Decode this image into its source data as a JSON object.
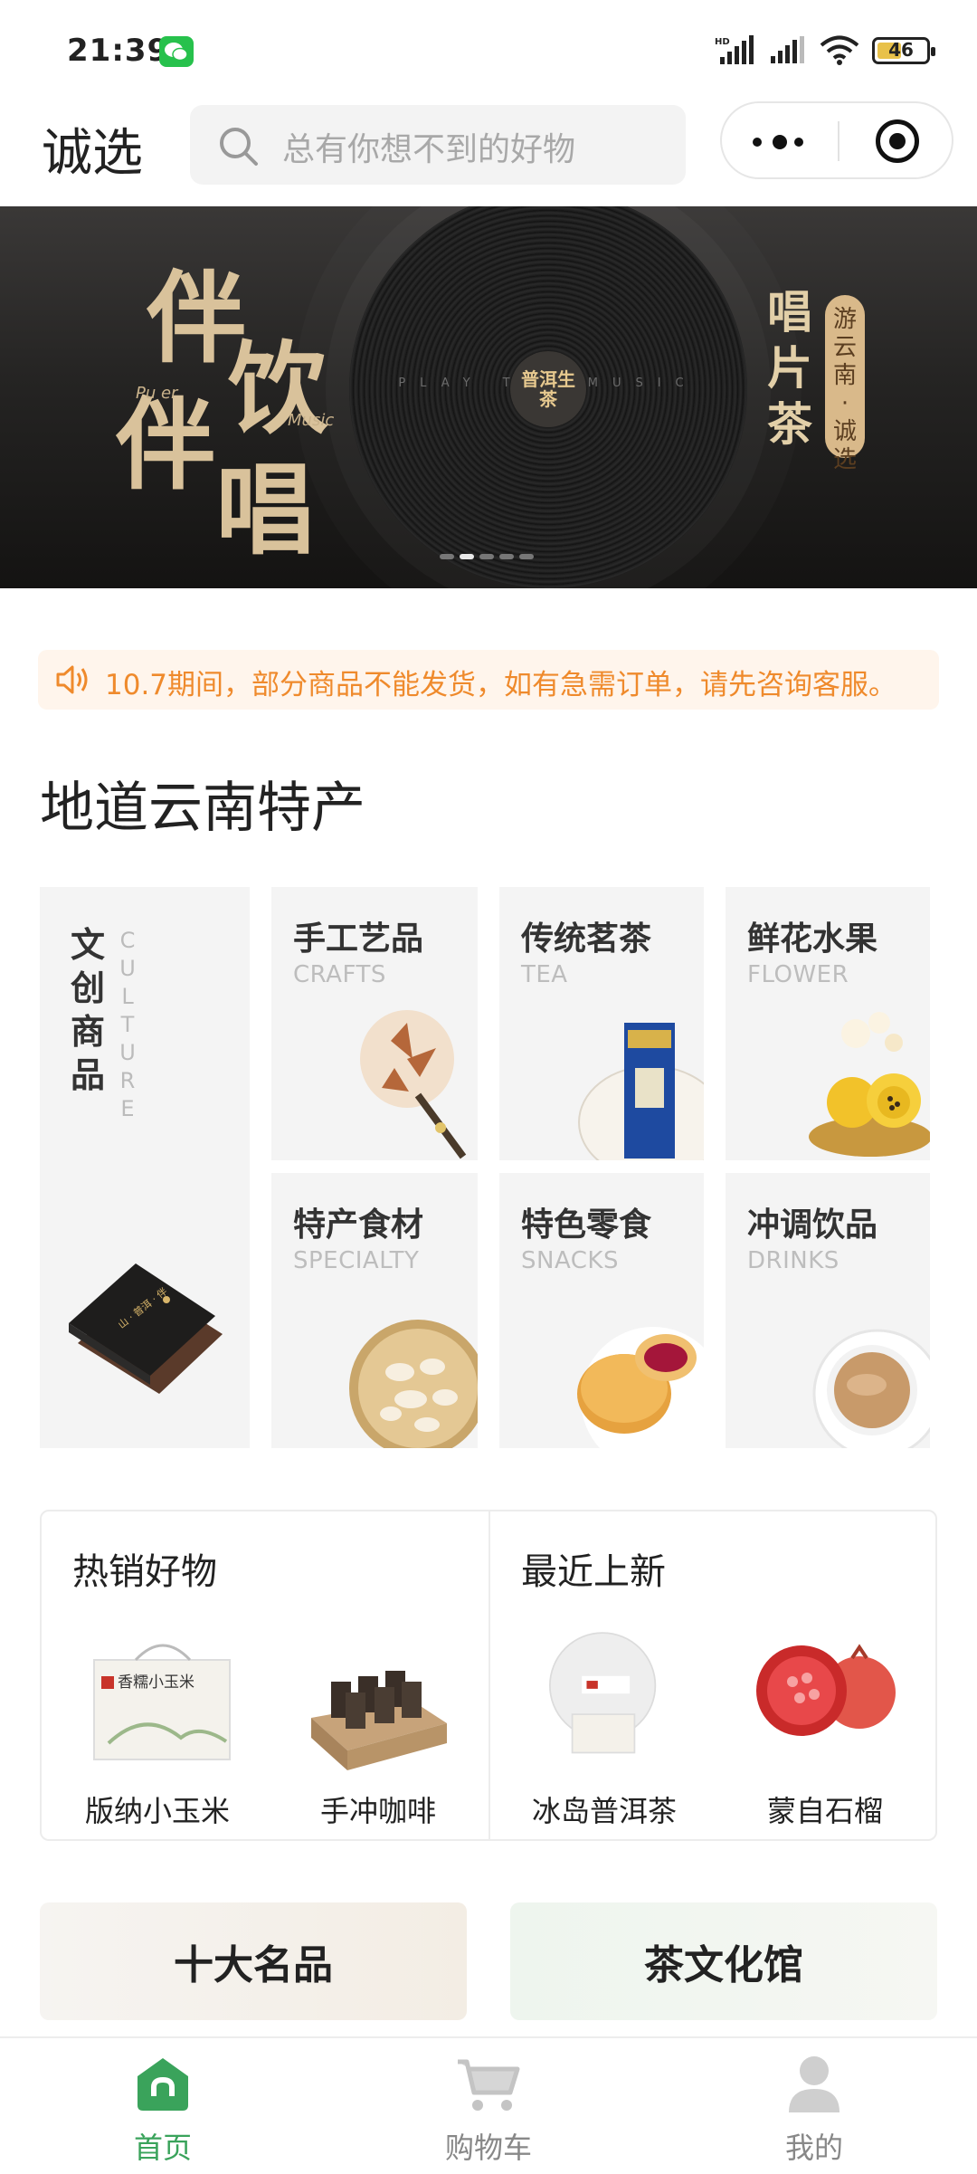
{
  "status_bar": {
    "time": "21:39",
    "network": "HD",
    "battery": "46"
  },
  "header": {
    "brand": "诚选",
    "search_placeholder": "总有你想不到的好物"
  },
  "banner": {
    "line1": "伴",
    "line2": "饮",
    "line3": "伴",
    "line4": "唱",
    "small1": "Pu er",
    "small2": "Music",
    "vertical_title": "唱片茶",
    "vertical_tag": "游云南·诚选",
    "record_label": "普洱生茶",
    "record_text": "PLAY THE MUSIC",
    "dots": 5,
    "active_dot": 1
  },
  "notice": {
    "text": "10.7期间，部分商品不能发货，如有急需订单，请先咨询客服。"
  },
  "section": {
    "title": "地道云南特产"
  },
  "categories": {
    "big": {
      "title": "文创商品",
      "subtitle": "CULTURE"
    },
    "items": [
      {
        "title": "手工艺品",
        "subtitle": "CRAFTS"
      },
      {
        "title": "传统茗茶",
        "subtitle": "TEA"
      },
      {
        "title": "鲜花水果",
        "subtitle": "FLOWER"
      },
      {
        "title": "特产食材",
        "subtitle": "SPECIALTY"
      },
      {
        "title": "特色零食",
        "subtitle": "SNACKS"
      },
      {
        "title": "冲调饮品",
        "subtitle": "DRINKS"
      }
    ]
  },
  "hot": {
    "title": "热销好物",
    "items": [
      {
        "label": "版纳小玉米",
        "box_text": "香糯小玉米"
      },
      {
        "label": "手冲咖啡"
      }
    ]
  },
  "new": {
    "title": "最近上新",
    "items": [
      {
        "label": "冰岛普洱茶"
      },
      {
        "label": "蒙自石榴"
      }
    ]
  },
  "tiles": {
    "left": "十大名品",
    "right": "茶文化馆"
  },
  "tabs": [
    {
      "label": "首页",
      "icon": "home-icon",
      "active": true
    },
    {
      "label": "购物车",
      "icon": "cart-icon",
      "active": false
    },
    {
      "label": "我的",
      "icon": "user-icon",
      "active": false
    }
  ],
  "colors": {
    "accent": "#3aa35b",
    "notice": "#ef8a2c",
    "banner_gold": "#d9c29b"
  }
}
